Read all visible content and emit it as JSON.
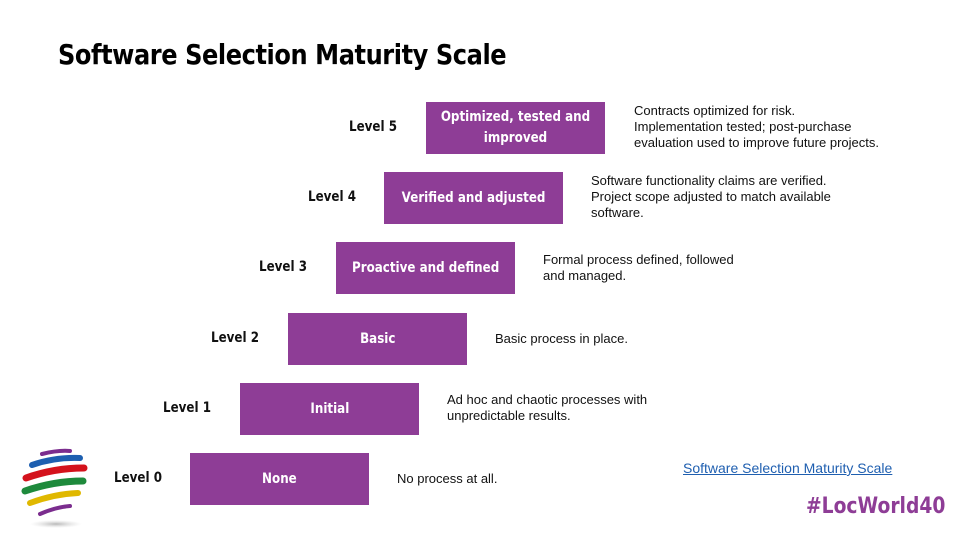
{
  "slide": {
    "title": "Software Selection Maturity Scale",
    "accent_color": "#8e3d96"
  },
  "levels": [
    {
      "label": "Level 5",
      "name": "Optimized, tested and improved",
      "description": "Contracts optimized for risk.\nImplementation tested; post-purchase\nevaluation used to improve future projects."
    },
    {
      "label": "Level 4",
      "name": "Verified and adjusted",
      "description": "Software functionality claims are verified.\nProject scope adjusted to match available\nsoftware."
    },
    {
      "label": "Level 3",
      "name": "Proactive and defined",
      "description": "Formal process defined, followed\nand managed."
    },
    {
      "label": "Level 2",
      "name": "Basic",
      "description": "Basic process in place."
    },
    {
      "label": "Level 1",
      "name": "Initial",
      "description": "Ad hoc and chaotic processes with\nunpredictable results."
    },
    {
      "label": "Level 0",
      "name": "None",
      "description": "No process at all."
    }
  ],
  "footer": {
    "link_text": "Software Selection Maturity  Scale",
    "hashtag": "#LocWorld40",
    "logo_icon": "striped-globe-logo"
  }
}
